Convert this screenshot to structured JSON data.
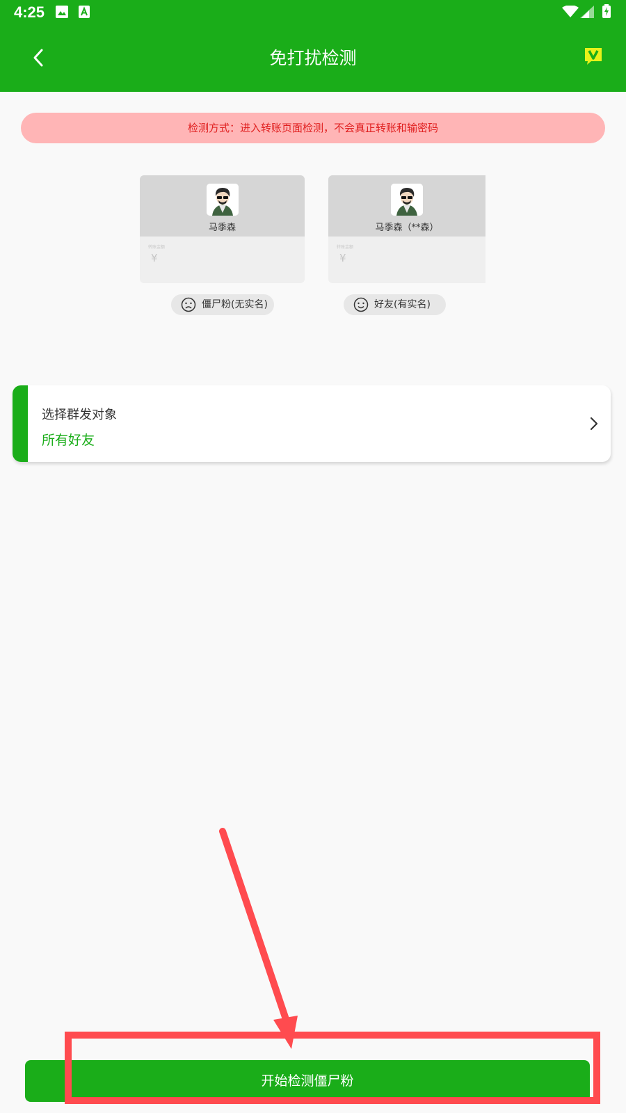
{
  "status_bar": {
    "time": "4:25"
  },
  "header": {
    "title": "免打扰检测",
    "back_icon": "chevron-left-icon",
    "vip_icon": "vip-badge-icon"
  },
  "notice": "检测方式：进入转账页面检测，不会真正转账和输密码",
  "examples": [
    {
      "name": "马季森",
      "amount_label": "转账金额",
      "currency": "¥",
      "tag": "僵尸粉(无实名)",
      "tag_icon": "sad-face-icon"
    },
    {
      "name": "马季森（**森）",
      "amount_label": "转账金额",
      "currency": "¥",
      "tag": "好友(有实名)",
      "tag_icon": "happy-face-icon"
    }
  ],
  "target": {
    "label": "选择群发对象",
    "value": "所有好友",
    "icon": "chevron-right-icon"
  },
  "action": {
    "start_label": "开始检测僵尸粉"
  },
  "colors": {
    "accent": "#1aad19",
    "notice_bg": "#ffb5b6",
    "notice_text": "#e02020",
    "annotation": "#ff4b4f"
  }
}
